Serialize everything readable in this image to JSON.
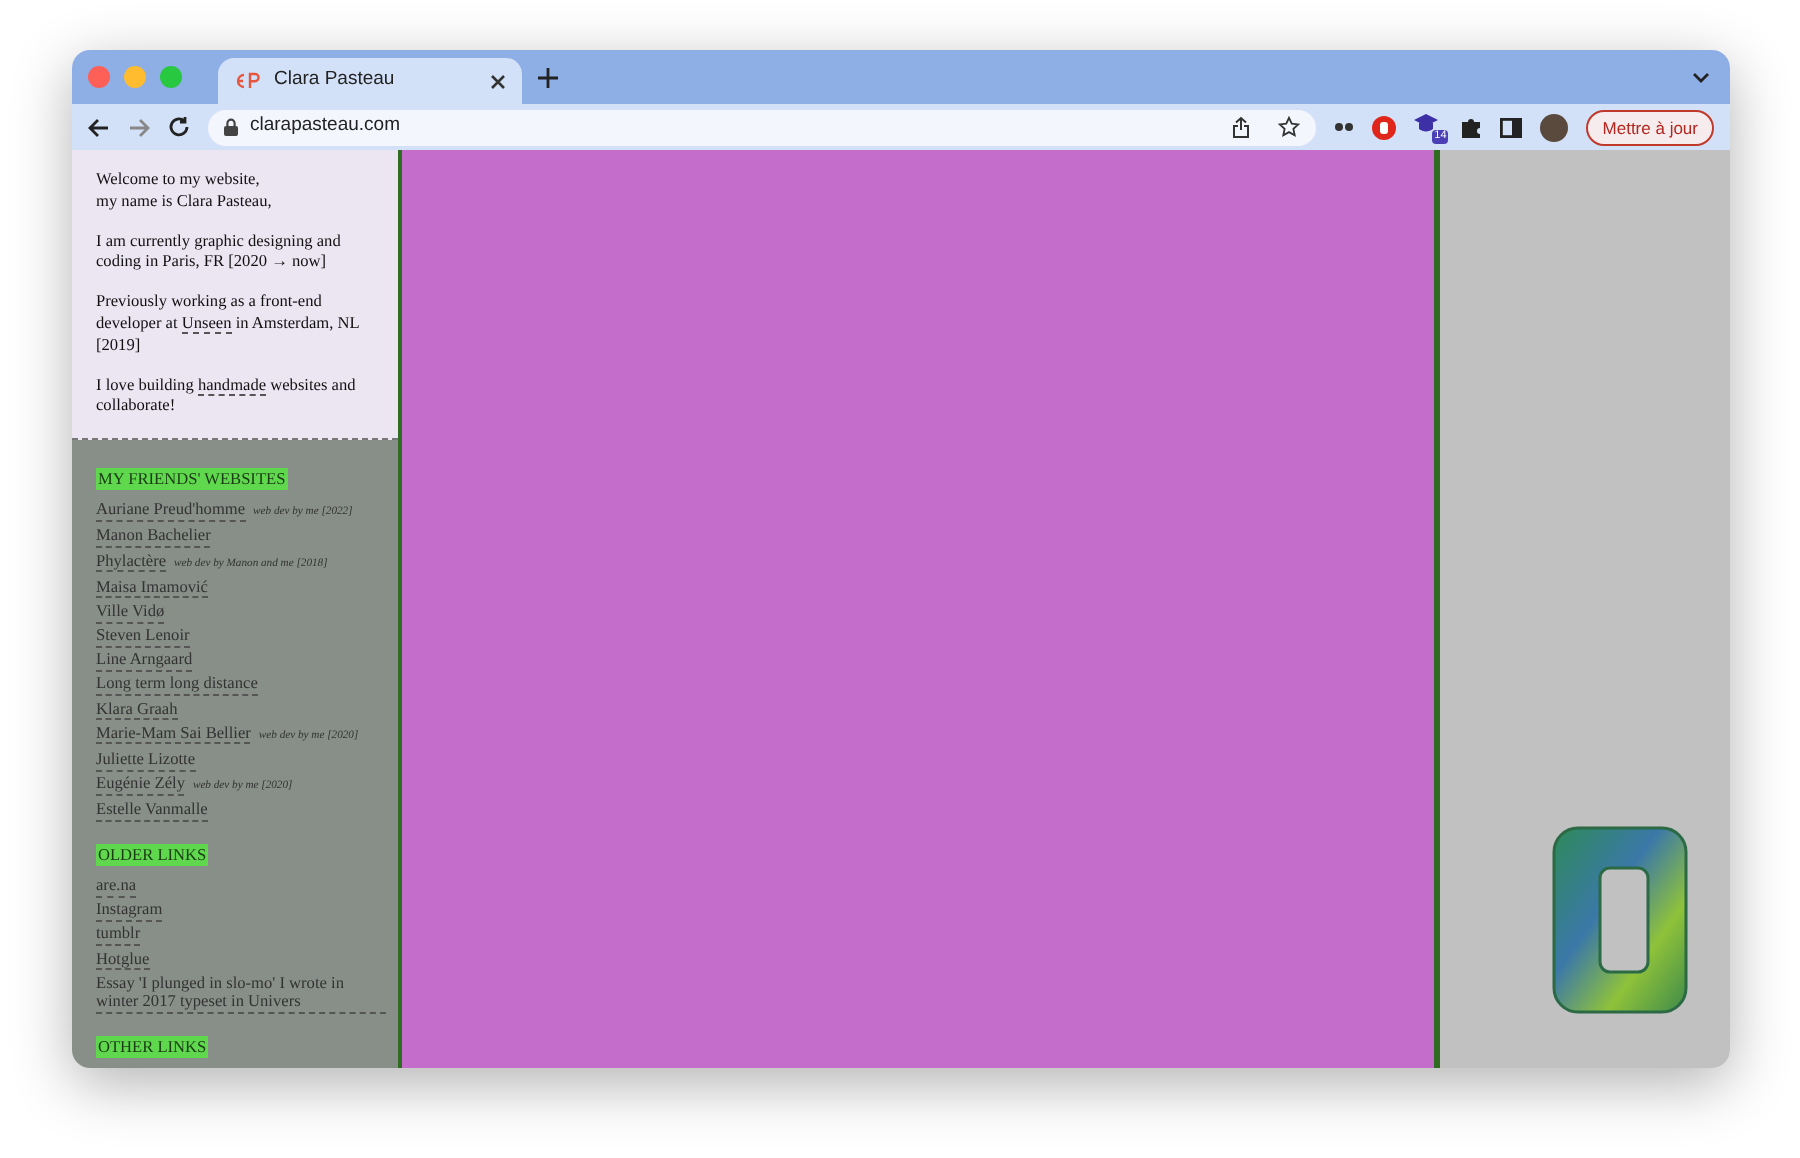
{
  "browser": {
    "tab_title": "Clara Pasteau",
    "url": "clarapasteau.com",
    "update_button": "Mettre à jour",
    "extension_badge": "14"
  },
  "intro": [
    [
      {
        "text": "Welcome to my website,",
        "link": false
      }
    ],
    [
      {
        "text": "my name is Clara Pasteau,",
        "link": false
      }
    ],
    [
      {
        "text": "I am currently graphic designing and coding in Paris, FR [2020 → now]",
        "link": false
      }
    ],
    [
      {
        "text": "Previously working as a front-end developer at",
        "link": false
      },
      {
        "text": "Unseen",
        "link": true
      },
      {
        "text": "in Amsterdam, NL [2019]",
        "link": false
      }
    ],
    [
      {
        "text": "I love building",
        "link": false
      },
      {
        "text": "handmade",
        "link": true
      },
      {
        "text": "websites and collaborate!",
        "link": false
      }
    ]
  ],
  "sections": [
    {
      "heading": "MY FRIENDS' WEBSITES",
      "links": [
        {
          "label": "Auriane Preud'homme",
          "note": "web dev by me [2022]"
        },
        {
          "label": "Manon Bachelier"
        },
        {
          "label": "Phylactère",
          "note": "web dev by Manon and me [2018]"
        },
        {
          "label": "Maisa Imamović"
        },
        {
          "label": "Ville Vidø"
        },
        {
          "label": "Steven Lenoir"
        },
        {
          "label": "Line Arngaard"
        },
        {
          "label": "Long term long distance"
        },
        {
          "label": "Klara Graah"
        },
        {
          "label": "Marie-Mam Sai Bellier",
          "note": "web dev by me [2020]"
        },
        {
          "label": "Juliette Lizotte"
        },
        {
          "label": "Eugénie Zély",
          "note": "web dev by me [2020]"
        },
        {
          "label": "Estelle Vanmalle"
        }
      ]
    },
    {
      "heading": "OLDER LINKS",
      "links": [
        {
          "label": "are.na"
        },
        {
          "label": "Instagram"
        },
        {
          "label": "tumblr"
        },
        {
          "label": "Hotglue"
        },
        {
          "label": "Essay 'I plunged in slo-mo' I wrote in winter 2017 typeset in Univers"
        }
      ]
    },
    {
      "heading": "OTHER LINKS"
    }
  ]
}
